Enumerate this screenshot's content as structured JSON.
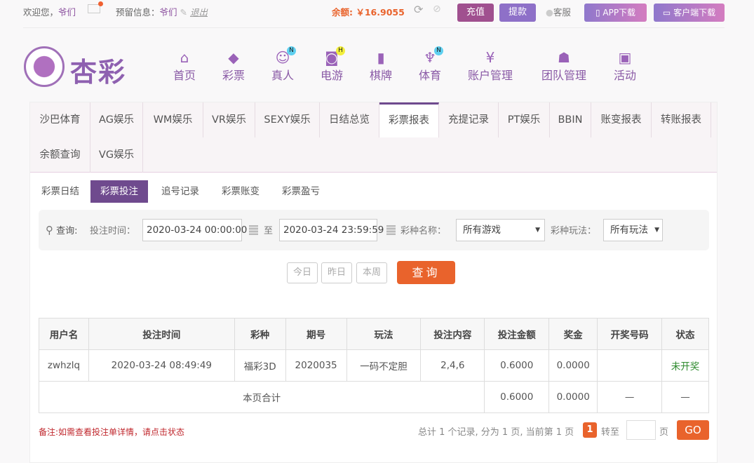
{
  "topbar": {
    "welcome": "欢迎您，",
    "username": "爷们",
    "reserved_label": "预留信息：",
    "reserved_value": "爷们",
    "logout": "退出",
    "balance_label": "余额:",
    "balance_value": "￥16.9055",
    "recharge": "充值",
    "withdraw": "提款",
    "service": "客服",
    "app_download": "APP下载",
    "client_download": "客户端下载"
  },
  "logo": {
    "text": "杏彩"
  },
  "nav": [
    {
      "label": "首页",
      "icon": "home-icon"
    },
    {
      "label": "彩票",
      "icon": "ticket-icon"
    },
    {
      "label": "真人",
      "icon": "dealer-icon",
      "badge": "N"
    },
    {
      "label": "电游",
      "icon": "gamepad-icon",
      "badge": "H"
    },
    {
      "label": "棋牌",
      "icon": "cards-icon"
    },
    {
      "label": "体育",
      "icon": "trophy-icon",
      "badge": "N"
    },
    {
      "label": "账户管理",
      "icon": "yen-coin-icon"
    },
    {
      "label": "团队管理",
      "icon": "team-icon"
    },
    {
      "label": "活动",
      "icon": "gift-icon"
    }
  ],
  "report_tabs": [
    "沙巴体育",
    "AG娱乐",
    "WM娱乐",
    "VR娱乐",
    "SEXY娱乐",
    "日结总览",
    "彩票报表",
    "充提记录",
    "PT娱乐",
    "BBIN",
    "账变报表",
    "转账报表",
    "余额查询",
    "VG娱乐"
  ],
  "active_report_tab": "彩票报表",
  "sub_tabs": [
    "彩票日结",
    "彩票投注",
    "追号记录",
    "彩票账变",
    "彩票盈亏"
  ],
  "active_sub_tab": "彩票投注",
  "filter": {
    "query_label": "查询:",
    "time_label": "投注时间：",
    "start": "2020-03-24 00:00:00",
    "to": "至",
    "end": "2020-03-24 23:59:59",
    "game_label": "彩种名称：",
    "game_value": "所有游戏",
    "play_label": "彩种玩法：",
    "play_value": "所有玩法"
  },
  "quick": {
    "today": "今日",
    "yesterday": "昨日",
    "week": "本周",
    "search": "查询"
  },
  "table": {
    "headers": [
      "用户名",
      "投注时间",
      "彩种",
      "期号",
      "玩法",
      "投注内容",
      "投注金额",
      "奖金",
      "开奖号码",
      "状态"
    ],
    "rows": [
      [
        "zwhzlq",
        "2020-03-24 08:49:49",
        "福彩3D",
        "2020035",
        "一码不定胆",
        "2,4,6",
        "0.6000",
        "0.0000",
        "",
        "未开奖"
      ]
    ],
    "total": {
      "label": "本页合计",
      "amount": "0.6000",
      "bonus": "0.0000",
      "numbers": "—",
      "status": "—"
    }
  },
  "note": "备注:如需查看投注单详情，请点击状态",
  "pager": {
    "summary": "总计 1 个记录, 分为 1 页, 当前第 1 页",
    "current": "1",
    "goto": "转至",
    "page": "页",
    "go": "GO"
  },
  "colors": {
    "accent": "#6f4a8e",
    "orange": "#e9632c",
    "pending": "#2e8b2e"
  }
}
